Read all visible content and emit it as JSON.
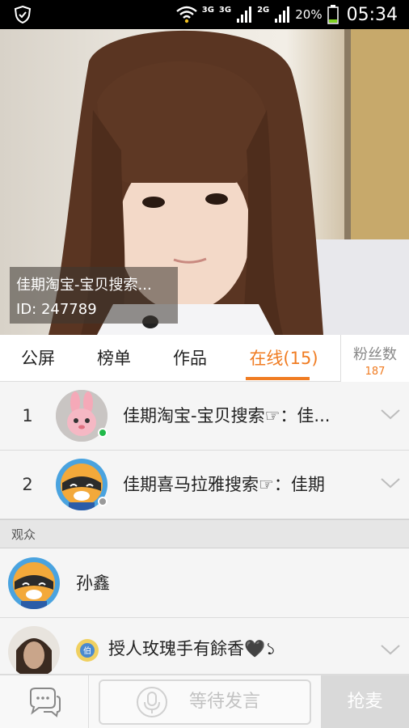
{
  "status_bar": {
    "net_3g_a": "3G",
    "net_3g_b": "3G",
    "net_2g": "2G",
    "battery": "20%",
    "time": "05:34"
  },
  "host": {
    "name": "佳期淘宝-宝贝搜索...",
    "id": "ID: 247789"
  },
  "tabs": [
    {
      "label": "公屏"
    },
    {
      "label": "榜单"
    },
    {
      "label": "作品"
    },
    {
      "label": "在线(15)"
    }
  ],
  "fans": {
    "label": "粉丝数",
    "count": "187"
  },
  "ranked": [
    {
      "rank": "1",
      "name": "佳期淘宝-宝贝搜索☞：佳...",
      "avatar": "pink-rabbit-avatar",
      "status_color": "#21b94a"
    },
    {
      "rank": "2",
      "name": "佳期喜马拉雅搜索☞：佳期",
      "avatar": "raccoon-mascot-avatar",
      "status_color": "#9a9a9a"
    }
  ],
  "audience": {
    "header": "观众",
    "items": [
      {
        "name": "孙鑫",
        "avatar": "raccoon-mascot-avatar"
      },
      {
        "name": "授人玫瑰手有餘香🖤১",
        "avatar": "photo-avatar"
      }
    ]
  },
  "bottom": {
    "wait_label": "等待发言",
    "grab_label": "抢麦"
  },
  "colors": {
    "accent": "#f07c22",
    "online": "#21b94a"
  }
}
